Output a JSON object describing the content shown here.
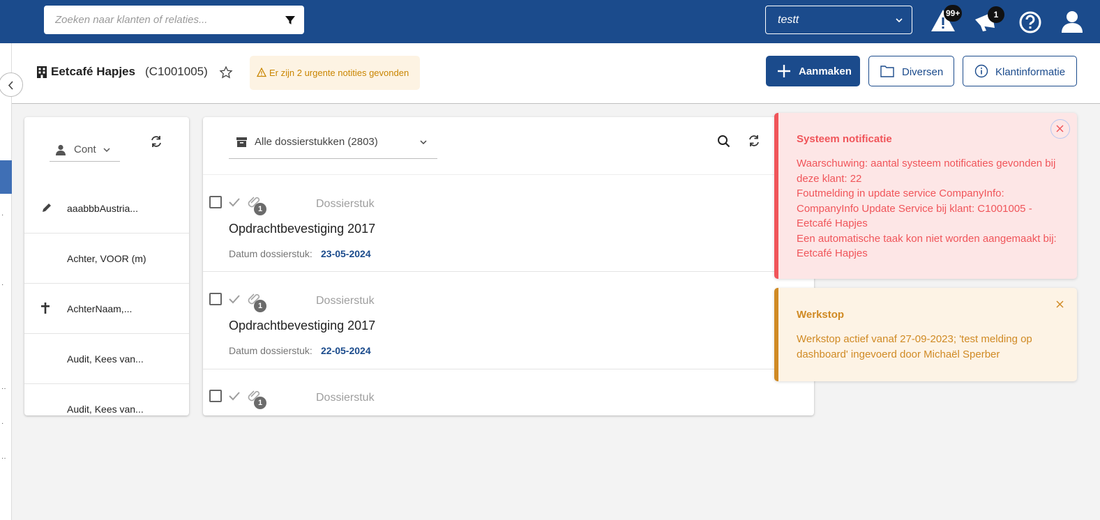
{
  "topbar": {
    "search_placeholder": "Zoeken naar klanten of relaties...",
    "tenant_value": "testt",
    "alert_badge": "99+",
    "notification_badge": "1"
  },
  "header": {
    "client_name": "Eetcafé Hapjes",
    "client_code": "(C1001005)",
    "urgent_notice": "Er zijn 2 urgente notities gevonden",
    "create_label": "Aanmaken",
    "misc_label": "Diversen",
    "info_label": "Klantinformatie"
  },
  "contacts": {
    "select_label": "Cont",
    "items": [
      {
        "name": "aaabbbAustria...",
        "icon": "pencil-icon"
      },
      {
        "name": "Achter, VOOR (m)",
        "icon": ""
      },
      {
        "name": "AchterNaam,...",
        "icon": "cross-icon"
      },
      {
        "name": "Audit, Kees van...",
        "icon": ""
      },
      {
        "name": "Audit, Kees van...",
        "icon": ""
      }
    ]
  },
  "documents": {
    "select_label": "Alle dossierstukken (2803)",
    "date_label": "Datum dossierstuk:",
    "items": [
      {
        "type": "Dossierstuk",
        "title": "Opdrachtbevestiging 2017",
        "date": "23-05-2024",
        "attachments": "1"
      },
      {
        "type": "Dossierstuk",
        "title": "Opdrachtbevestiging 2017",
        "date": "22-05-2024",
        "attachments": "1"
      },
      {
        "type": "Dossierstuk",
        "title": "",
        "date": "",
        "attachments": "1"
      }
    ]
  },
  "notifications": {
    "system": {
      "title": "Systeem notificatie",
      "lines": [
        "Waarschuwing: aantal systeem notificaties gevonden bij deze klant: 22",
        "Foutmelding in update service CompanyInfo: CompanyInfo Update Service bij klant: C1001005 - Eetcafé Hapjes",
        "Een automatische taak kon niet worden aangemaakt bij: Eetcafé Hapjes"
      ]
    },
    "werkstop": {
      "title": "Werkstop",
      "body": "Werkstop actief vanaf 27-09-2023; 'test melding op dashboard' ingevoerd door Michaël Sperber"
    }
  },
  "colors": {
    "brand": "#1b4b8c",
    "error": "#f0555a",
    "warning": "#d08a24"
  }
}
